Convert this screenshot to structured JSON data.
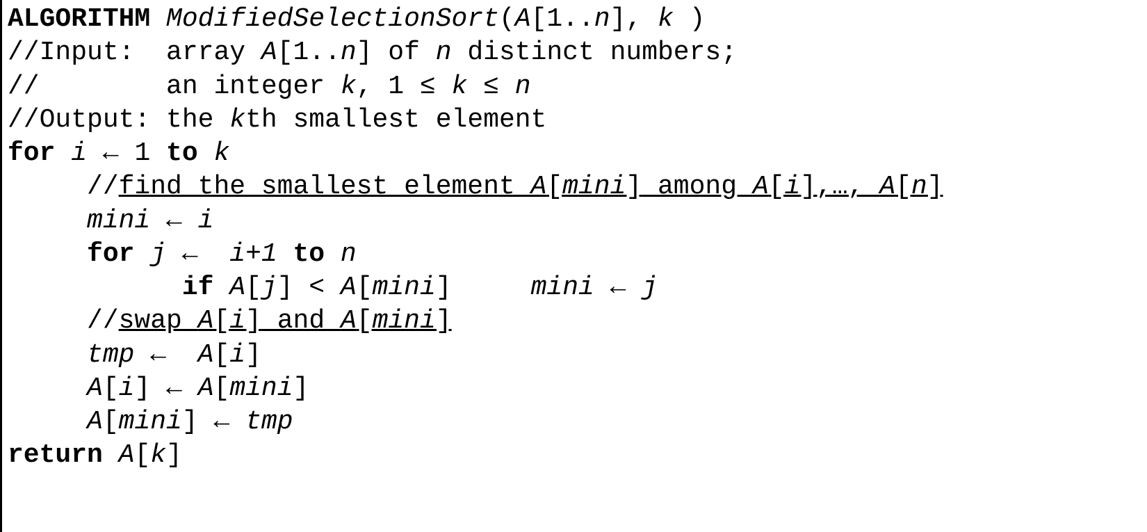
{
  "header": {
    "keyword": "ALGORITHM ",
    "name": "ModifiedSelectionSort",
    "params_open": "(",
    "params_inner_pre": "A",
    "params_bracket": "[1..",
    "n": "n",
    "params_close_bracket": "]",
    "comma_k": ", ",
    "k": "k",
    "params_close": " )"
  },
  "c_input_pre": "//Input:  array ",
  "c_input_arr": "A",
  "c_input_br": "[1..",
  "c_input_n": "n",
  "c_input_cb": "] of ",
  "c_input_n2": "n",
  "c_input_rest": " distinct numbers;",
  "c_indent": "//        an integer ",
  "c_k": "k",
  "c_range_pre": ", 1 ≤ ",
  "c_k2": "k",
  "c_range_mid": " ≤ ",
  "c_n3": "n",
  "c_output_pre": "//Output: the ",
  "c_output_k": "k",
  "c_output_rest": "th smallest element",
  "for_kw": "for ",
  "i": "i",
  "arrow": " ← ",
  "one": "1",
  "to_kw": " to ",
  "k_var": "k",
  "c_find_pre": "//",
  "c_find_u1": "find the smallest element ",
  "c_find_A": "A",
  "c_find_ob": "[",
  "c_find_mini": "mini",
  "c_find_cb": "]",
  "c_find_among": " among ",
  "c_find_A2": "A",
  "c_find_ob2": "[",
  "c_find_i": "i",
  "c_find_cb2": "]",
  "c_find_dots": ",…, ",
  "c_find_A3": "A",
  "c_find_ob3": "[",
  "c_find_n": "n",
  "c_find_cb3": "]",
  "mini_var": "mini",
  "inner_for_kw": "for ",
  "j": "j",
  "iplus1": "i+1",
  "n_var": "n",
  "if_kw": "if ",
  "A_j": "A",
  "ob_j": "[",
  "j2": "j",
  "cb_j": "]",
  "lt": " < ",
  "A_mini": "A",
  "ob_mini": "[",
  "mini2": "mini",
  "cb_mini": "]",
  "space_gap": "     ",
  "mini3": "mini",
  "j3": "j",
  "c_swap_pre": "//",
  "c_swap_u": "swap ",
  "c_swap_A1": "A",
  "c_swap_ob1": "[",
  "c_swap_i1": "i",
  "c_swap_cb1": "]",
  "c_swap_and": " and ",
  "c_swap_A2": "A",
  "c_swap_ob2": "[",
  "c_swap_mini": "mini",
  "c_swap_cb2": "]",
  "tmp": "tmp",
  "A1": "A",
  "ob1": "[",
  "i1": "i",
  "cb1": "]",
  "A2": "A",
  "ob2": "[",
  "i2": "i",
  "cb2": "]",
  "A3": "A",
  "ob3": "[",
  "mini4": "mini",
  "cb3": "]",
  "A4": "A",
  "ob4": "[",
  "mini5": "mini",
  "cb4": "]",
  "tmp2": "tmp",
  "return_kw": "return ",
  "A5": "A",
  "ob5": "[",
  "k5": "k",
  "cb5": "]",
  "sp1": " ",
  "sp2": "  "
}
